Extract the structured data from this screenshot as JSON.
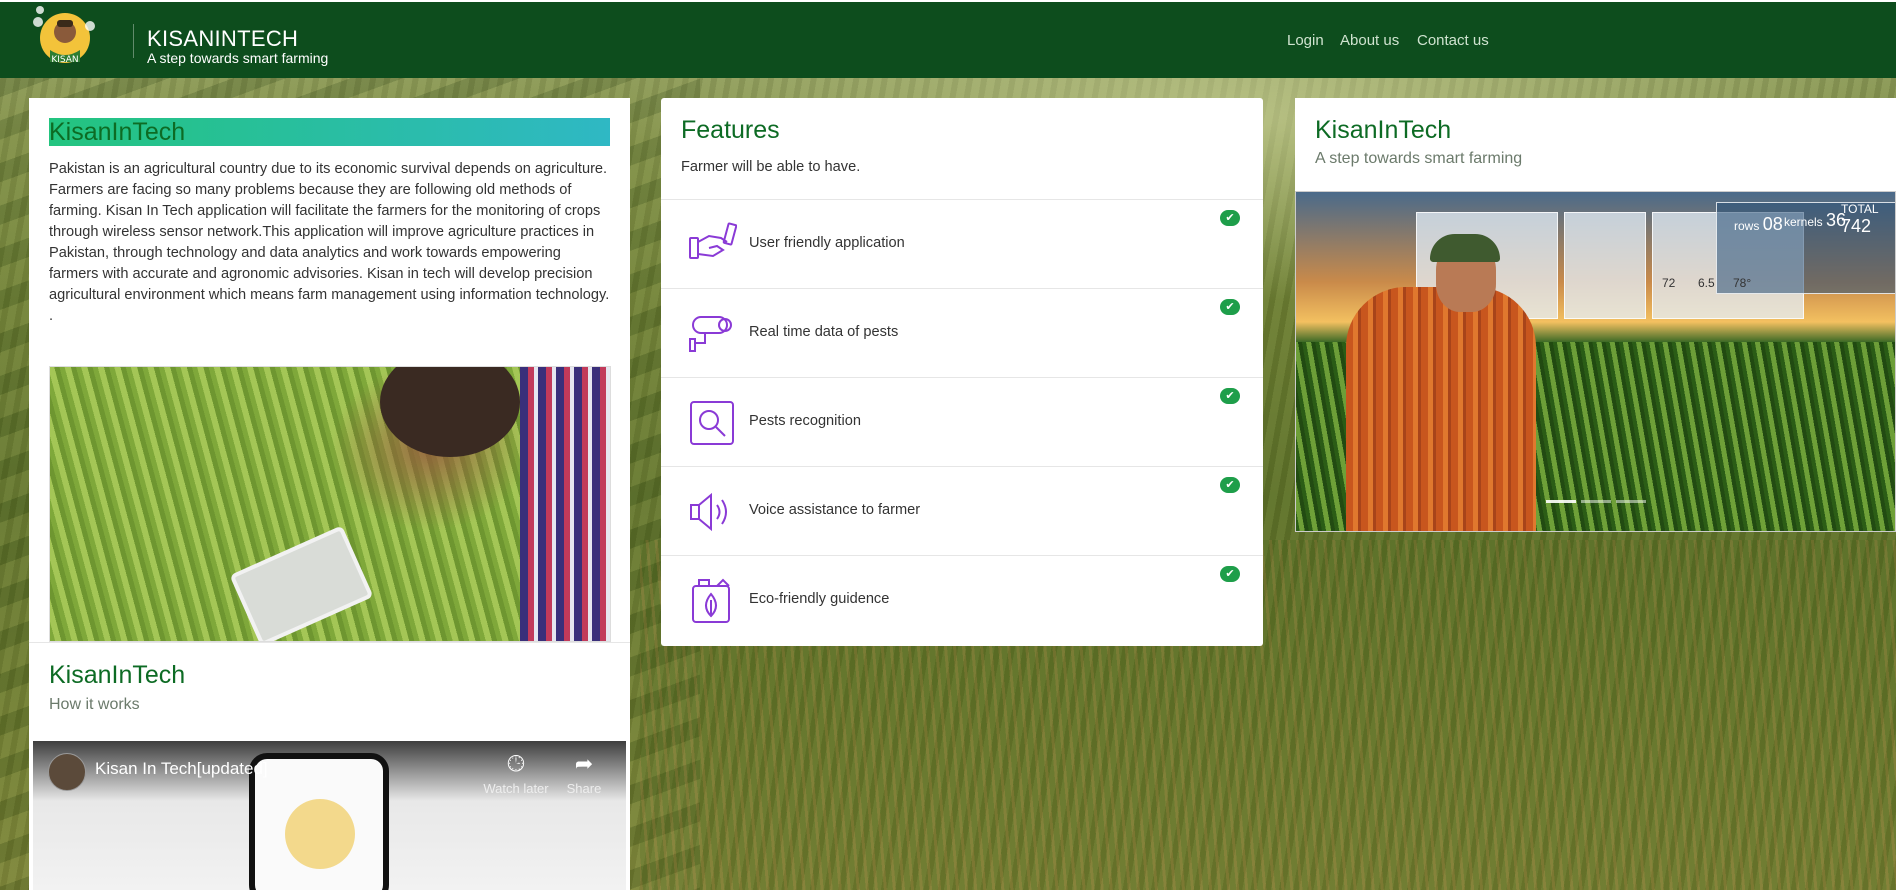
{
  "header": {
    "brand_title": "KISANINTECH",
    "brand_subtitle": "A step towards smart farming",
    "logo_text": "KISAN",
    "nav": [
      {
        "label": "Login"
      },
      {
        "label": "About us"
      },
      {
        "label": "Contact us"
      }
    ]
  },
  "intro_card": {
    "title": "KisanInTech",
    "paragraph": "Pakistan is an agricultural country due to its economic survival depends on agriculture. Farmers are facing so many problems because they are following old methods of farming. Kisan In Tech application will facilitate the farmers for the monitoring of crops through wireless sensor network.This application will improve agriculture practices in Pakistan, through technology and data analytics and work towards empowering farmers with accurate and agronomic advisories. Kisan in tech will develop precision agricultural environment which means farm management using information technology. .",
    "how_title": "KisanInTech",
    "how_subtitle": "How it works",
    "video": {
      "title": "Kisan In Tech[updated]",
      "watch_later": "Watch later",
      "share": "Share"
    }
  },
  "features_card": {
    "title": "Features",
    "subtitle": "Farmer will be able to have.",
    "items": [
      {
        "label": "User friendly application",
        "icon": "handshake-icon"
      },
      {
        "label": "Real time data of pests",
        "icon": "security-camera-icon"
      },
      {
        "label": "Pests recognition",
        "icon": "magnifier-icon"
      },
      {
        "label": "Voice assistance to farmer",
        "icon": "speaker-icon"
      },
      {
        "label": "Eco-friendly guidence",
        "icon": "eco-canister-icon"
      }
    ],
    "check_color": "#1e9e4a"
  },
  "slider_card": {
    "title": "KisanInTech",
    "subtitle": "A step towards smart farming",
    "hud": {
      "rows_label": "rows",
      "rows_value": "08",
      "kernels_label": "kernels",
      "kernels_value": "36",
      "total_label": "TOTAL",
      "total_value": "742",
      "gauge1": "72",
      "gauge2": "6.5",
      "gauge3": "78°"
    }
  },
  "colors": {
    "header_bg": "#0d4d1d",
    "title_green": "#0d6b24",
    "highlight_start": "#23c47f",
    "highlight_end": "#2fb8c4"
  }
}
